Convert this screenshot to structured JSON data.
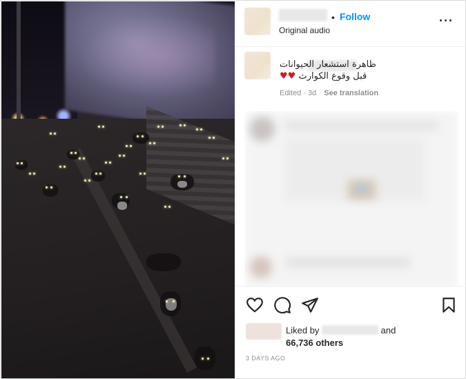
{
  "post": {
    "follow_separator": "•",
    "follow_label": "Follow",
    "audio_label": "Original audio",
    "more_glyph": "···",
    "caption_line1": "ظاهرة استشعار الحيوانات",
    "caption_line2": "قبل وقوع الكوارث",
    "caption_hearts": "♥♥",
    "edited_label": "Edited · 3d",
    "see_translation": "See translation",
    "liked_by_prefix": "Liked by",
    "liked_by_and": "and",
    "likes_count": "66,736 others",
    "timestamp": "3 DAYS AGO"
  },
  "icons": {
    "like": "heart-outline-icon",
    "comment": "comment-icon",
    "share": "send-icon",
    "save": "bookmark-icon"
  },
  "colors": {
    "follow": "#0095f6",
    "heart": "#c81d25",
    "muted": "#8e8e8e"
  }
}
